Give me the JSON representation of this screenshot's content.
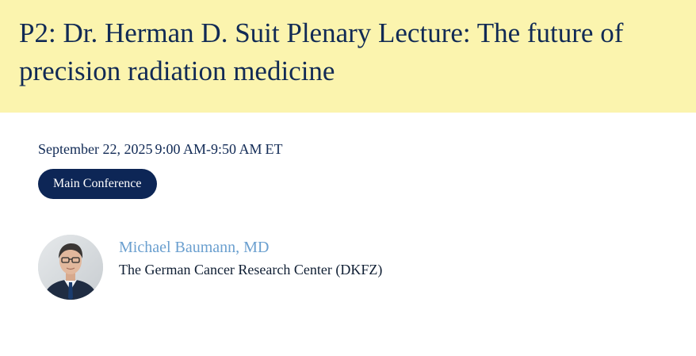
{
  "session": {
    "title": "P2: Dr. Herman D. Suit Plenary Lecture: The future of precision radiation medicine",
    "date": "September 22, 2025",
    "time": "9:00 AM-9:50 AM",
    "timezone": "ET",
    "track": "Main Conference"
  },
  "speaker": {
    "name": "Michael Baumann, MD",
    "organization": "The German Cancer Research Center (DKFZ)"
  },
  "colors": {
    "banner_bg": "#fbf4ae",
    "title_text": "#112a55",
    "pill_bg": "#0d2656",
    "speaker_link": "#6a9fcf"
  }
}
